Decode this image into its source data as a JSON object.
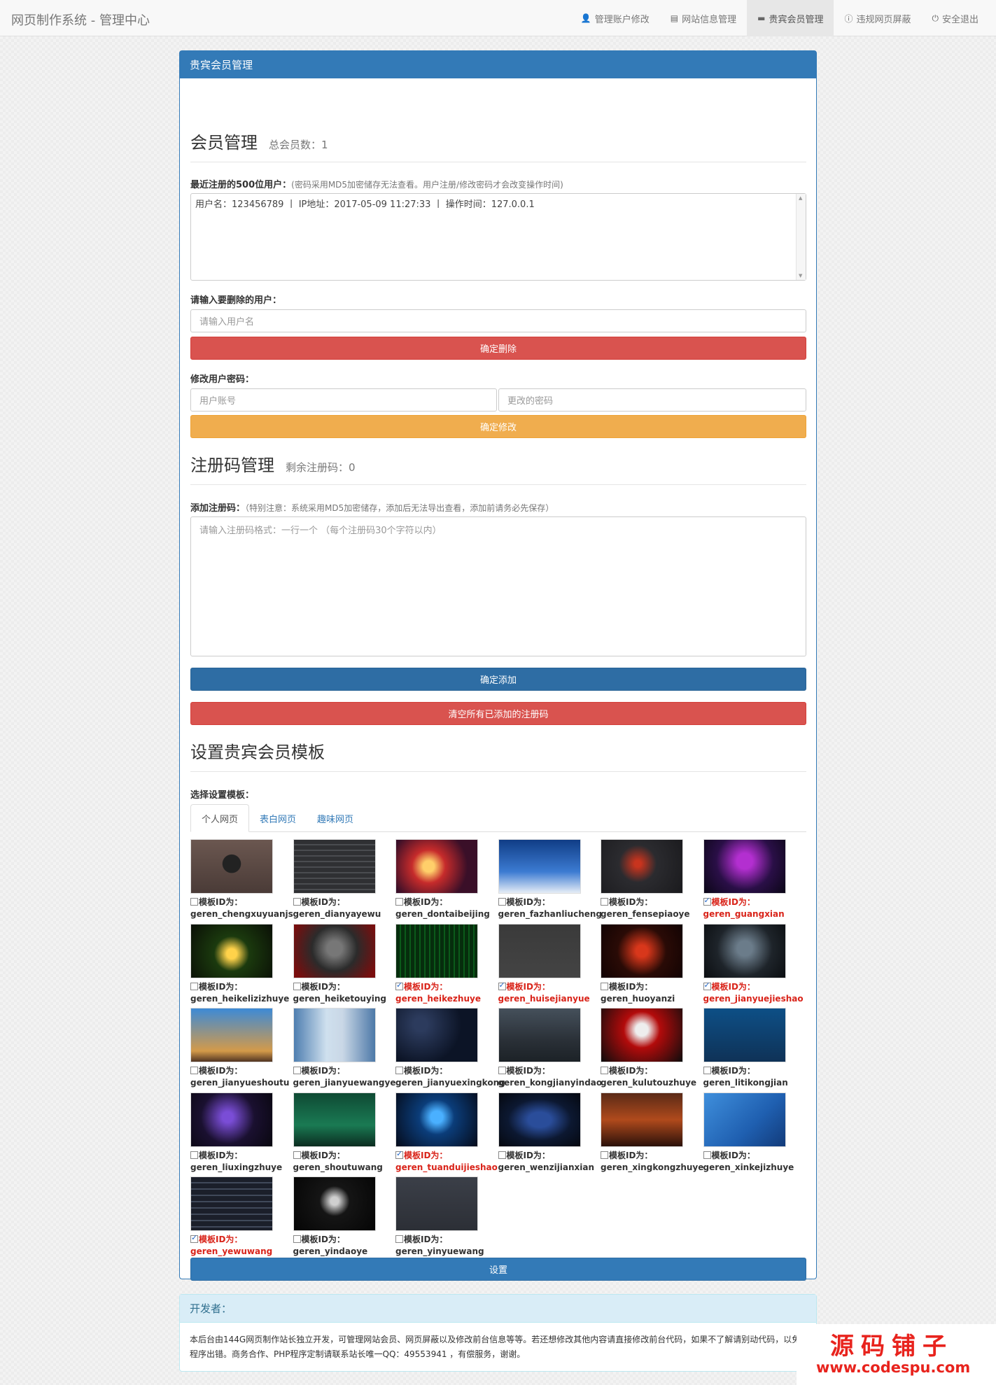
{
  "navbar": {
    "brand": "网页制作系统 - 管理中心",
    "items": [
      {
        "label": "管理账户修改",
        "icon": "user-icon"
      },
      {
        "label": "网站信息管理",
        "icon": "list-icon"
      },
      {
        "label": "贵宾会员管理",
        "icon": "comment-icon",
        "active": true
      },
      {
        "label": "违规网页屏蔽",
        "icon": "info-icon"
      },
      {
        "label": "安全退出",
        "icon": "power-icon"
      }
    ]
  },
  "panel": {
    "heading": "贵宾会员管理",
    "member": {
      "title": "会员管理",
      "count": "总会员数：1",
      "recent_label": "最近注册的500位用户：",
      "recent_note": "(密码采用MD5加密储存无法查看。用户注册/修改密码才会改变操作时间)",
      "recent_text": "用户名：123456789 丨 IP地址：2017-05-09 11:27:33 丨 操作时间：127.0.0.1",
      "delete_label": "请输入要删除的用户：",
      "delete_placeholder": "请输入用户名",
      "delete_button": "确定删除",
      "pwd_label": "修改用户密码：",
      "pwd_account_placeholder": "用户账号",
      "pwd_new_placeholder": "更改的密码",
      "pwd_button": "确定修改"
    },
    "code": {
      "title": "注册码管理",
      "remaining": "剩余注册码：0",
      "add_label": "添加注册码：",
      "add_note": "（特别注意：系统采用MD5加密储存，添加后无法导出查看，添加前请务必先保存）",
      "add_placeholder": "请输入注册码格式：一行一个 （每个注册码30个字符以内）",
      "add_button": "确定添加",
      "clear_button": "清空所有已添加的注册码"
    },
    "template": {
      "title": "设置贵宾会员模板",
      "choose_label": "选择设置模板：",
      "tabs": [
        "个人网页",
        "表白网页",
        "趣味网页"
      ],
      "item_prefix": "模板ID为：",
      "items": [
        {
          "id": "geren_chengxuyuanjs",
          "checked": false
        },
        {
          "id": "geren_dianyayewu",
          "checked": false
        },
        {
          "id": "geren_dontaibeijing",
          "checked": false
        },
        {
          "id": "geren_fazhanliucheng",
          "checked": false
        },
        {
          "id": "geren_fensepiaoye",
          "checked": false
        },
        {
          "id": "geren_guangxian",
          "checked": true
        },
        {
          "id": "geren_heikelizizhuye",
          "checked": false
        },
        {
          "id": "geren_heiketouying",
          "checked": false
        },
        {
          "id": "geren_heikezhuye",
          "checked": true
        },
        {
          "id": "geren_huisejianyue",
          "checked": true
        },
        {
          "id": "geren_huoyanzi",
          "checked": false
        },
        {
          "id": "geren_jianyuejieshao",
          "checked": true
        },
        {
          "id": "geren_jianyueshoutu",
          "checked": false
        },
        {
          "id": "geren_jianyuewangye",
          "checked": false
        },
        {
          "id": "geren_jianyuexingkong",
          "checked": false
        },
        {
          "id": "geren_kongjianyindao",
          "checked": false
        },
        {
          "id": "geren_kulutouzhuye",
          "checked": false
        },
        {
          "id": "geren_litikongjian",
          "checked": false
        },
        {
          "id": "geren_liuxingzhuye",
          "checked": false
        },
        {
          "id": "geren_shoutuwang",
          "checked": false
        },
        {
          "id": "geren_tuanduijieshao",
          "checked": true
        },
        {
          "id": "geren_wenzijianxian",
          "checked": false
        },
        {
          "id": "geren_xingkongzhuye",
          "checked": false
        },
        {
          "id": "geren_xinkejizhuye",
          "checked": false
        },
        {
          "id": "geren_yewuwang",
          "checked": true
        },
        {
          "id": "geren_yindaoye",
          "checked": false
        },
        {
          "id": "geren_yinyuewang",
          "checked": false
        }
      ],
      "set_button": "设置"
    }
  },
  "developer": {
    "heading": "开发者：",
    "text": "本后台由144G网页制作站长独立开发，可管理网站会员、网页屏蔽以及修改前台信息等等。若还想修改其他内容请直接修改前台代码，如果不了解请别动代码，以免程序出错。商务合作、PHP程序定制请联系站长唯一QQ：49553941 ，有偿服务，谢谢。"
  },
  "watermark": {
    "cn": "源码铺子",
    "en": "www.codespu.com"
  },
  "colors": {
    "primary": "#337ab7",
    "danger": "#d9534f",
    "warning": "#f0ad4e",
    "checked_text": "#d9241a"
  }
}
